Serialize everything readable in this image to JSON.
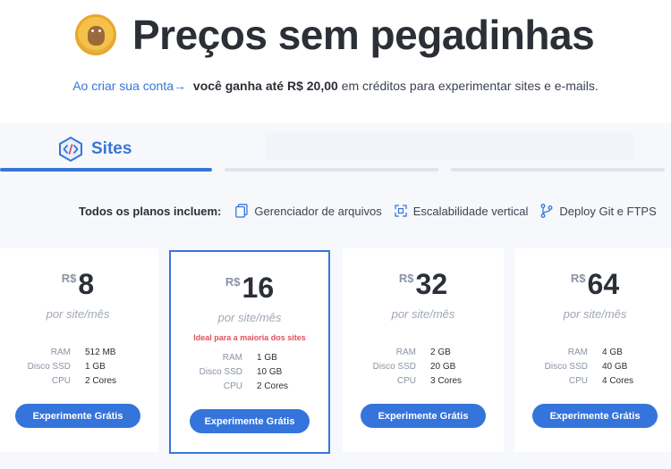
{
  "header": {
    "title": "Preços sem pegadinhas",
    "subtitle_link": "Ao criar sua conta",
    "subtitle_bold": "você ganha até R$ 20,00",
    "subtitle_rest": "em créditos para experimentar sites e e-mails."
  },
  "tabs": [
    {
      "label": "Sites",
      "active": true,
      "icon": "code-icon"
    }
  ],
  "includes": {
    "lead": "Todos os planos incluem:",
    "features": [
      {
        "icon": "files-icon",
        "label": "Gerenciador de arquivos"
      },
      {
        "icon": "scale-icon",
        "label": "Escalabilidade vertical"
      },
      {
        "icon": "git-branch-icon",
        "label": "Deploy Git e FTPS"
      }
    ]
  },
  "plans": [
    {
      "currency": "R$",
      "amount": "8",
      "period": "por site/mês",
      "highlight": "",
      "specs": [
        {
          "k": "RAM",
          "v": "512 MB"
        },
        {
          "k": "Disco SSD",
          "v": "1 GB"
        },
        {
          "k": "CPU",
          "v": "2 Cores"
        }
      ],
      "cta": "Experimente Grátis"
    },
    {
      "currency": "R$",
      "amount": "16",
      "period": "por site/mês",
      "highlight": "Ideal para a maioria dos sites",
      "specs": [
        {
          "k": "RAM",
          "v": "1 GB"
        },
        {
          "k": "Disco SSD",
          "v": "10 GB"
        },
        {
          "k": "CPU",
          "v": "2 Cores"
        }
      ],
      "cta": "Experimente Grátis"
    },
    {
      "currency": "R$",
      "amount": "32",
      "period": "por site/mês",
      "highlight": "",
      "specs": [
        {
          "k": "RAM",
          "v": "2 GB"
        },
        {
          "k": "Disco SSD",
          "v": "20 GB"
        },
        {
          "k": "CPU",
          "v": "3 Cores"
        }
      ],
      "cta": "Experimente Grátis"
    },
    {
      "currency": "R$",
      "amount": "64",
      "period": "por site/mês",
      "highlight": "",
      "specs": [
        {
          "k": "RAM",
          "v": "4 GB"
        },
        {
          "k": "Disco SSD",
          "v": "40 GB"
        },
        {
          "k": "CPU",
          "v": "4 Cores"
        }
      ],
      "cta": "Experimente Grátis"
    }
  ],
  "colors": {
    "accent": "#3776d6",
    "button": "#3474db",
    "highlight": "#e2505e",
    "coin": "#f4c24a"
  }
}
